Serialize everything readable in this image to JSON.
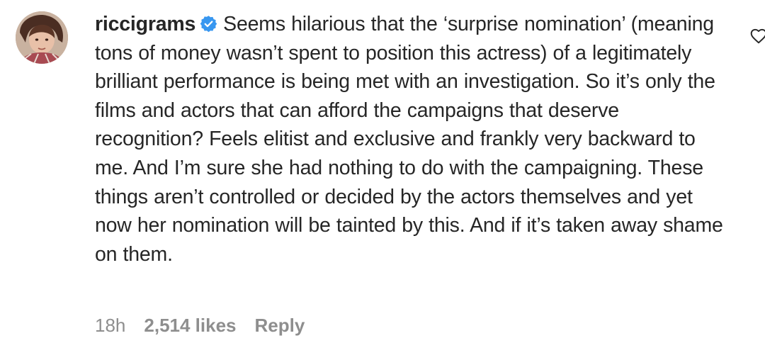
{
  "comment": {
    "username": "riccigrams",
    "verified_icon": "verified-badge-icon",
    "text": "Seems hilarious that the ‘surprise nomination’ (meaning tons of money wasn’t spent to position this actress) of a legitimately brilliant performance is being met with an investigation. So it’s only the films and actors that can afford the campaigns that deserve recognition? Feels elitist and exclusive and frankly very backward to me. And I’m sure she had nothing to do with the campaigning. These things aren’t controlled or decided by the actors themselves and yet now her nomination will be tainted by this. And if it’s taken away shame on them.",
    "time": "18h",
    "likes": "2,514 likes",
    "reply_label": "Reply",
    "like_icon": "heart-icon"
  },
  "colors": {
    "text": "#262626",
    "meta": "#8e8e8e",
    "verified": "#3897f0"
  }
}
